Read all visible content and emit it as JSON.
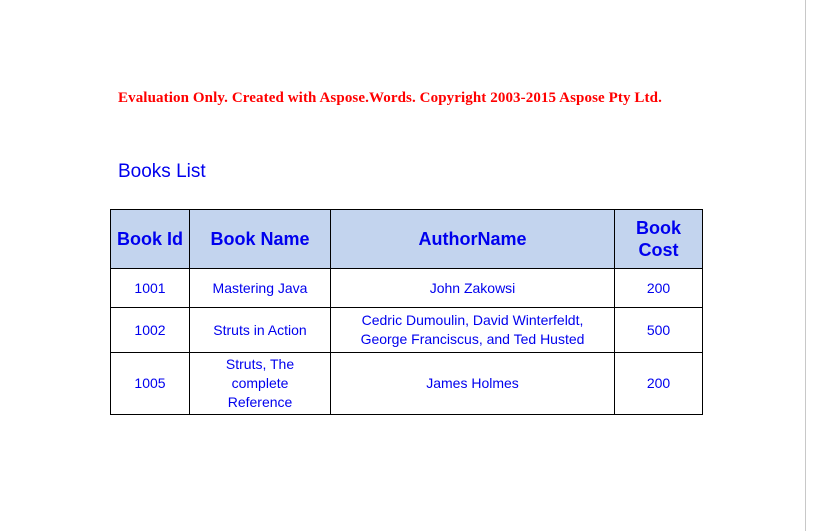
{
  "document": {
    "evaluation_notice": "Evaluation Only. Created with Aspose.Words. Copyright 2003-2015 Aspose Pty Ltd.",
    "title": "Books List"
  },
  "colors": {
    "notice_red": "#ff0000",
    "text_blue": "#0000ee",
    "header_background": "#c3d4ee",
    "border": "#000000",
    "page_background": "#ffffff"
  },
  "table": {
    "headers": [
      "Book Id",
      "Book Name",
      "AuthorName",
      "Book Cost"
    ],
    "rows": [
      {
        "book_id": "1001",
        "book_name": "Mastering Java",
        "author_name": "John Zakowsi",
        "book_cost": "200"
      },
      {
        "book_id": "1002",
        "book_name": "Struts in Action",
        "author_name": "Cedric Dumoulin, David Winterfeldt,\nGeorge Franciscus, and Ted Husted",
        "book_cost": "500"
      },
      {
        "book_id": "1005",
        "book_name": "Struts, The\ncomplete\nReference",
        "author_name": "James Holmes",
        "book_cost": "200"
      }
    ]
  }
}
